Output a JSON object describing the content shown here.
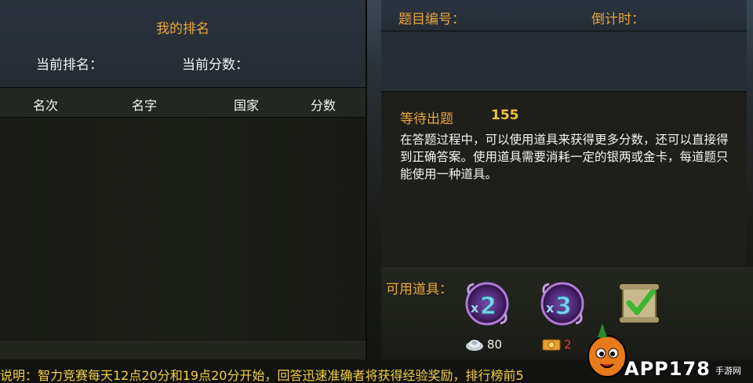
{
  "ranking": {
    "title": "我的排名",
    "current_rank_label": "当前排名：",
    "current_score_label": "当前分数：",
    "columns": [
      "名次",
      "名字",
      "国家",
      "分数"
    ]
  },
  "question": {
    "number_label": "题目编号：",
    "countdown_label": "倒计时：",
    "wait_label": "等待出题",
    "wait_value": "155",
    "description": "在答题过程中，可以使用道具来获得更多分数，还可以直接得到正确答案。使用道具需要消耗一定的银两或金卡，每道题只能使用一种道具。"
  },
  "items": {
    "label": "可用道具：",
    "list": [
      {
        "name": "x2",
        "icon": "double-score-icon",
        "cost": "80",
        "currency": "silver-icon"
      },
      {
        "name": "x3",
        "icon": "triple-score-icon",
        "cost": "2",
        "currency": "gold-card-icon"
      },
      {
        "name": "answer",
        "icon": "correct-answer-scroll-icon",
        "cost": "",
        "currency": ""
      }
    ]
  },
  "notice": "说明：智力竞赛每天12点20分和19点20分开始，回答迅速准确者将获得经验奖励，排行榜前5",
  "watermark": {
    "text": "APP178",
    "sub": "手游网"
  },
  "colors": {
    "accent": "#e8a53a",
    "notice": "#f2d042",
    "value": "#f0c040"
  }
}
